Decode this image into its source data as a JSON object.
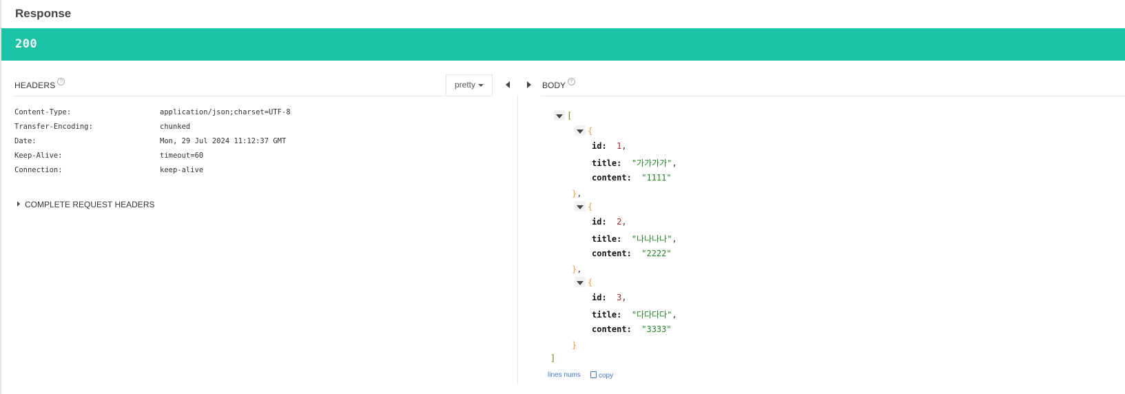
{
  "response": {
    "title": "Response",
    "status_code": "200"
  },
  "headers_panel": {
    "title": "HEADERS",
    "help": "?",
    "format_dropdown": "pretty",
    "rows": [
      {
        "key": "Content-Type:",
        "value": "application/json;charset=UTF-8"
      },
      {
        "key": "Transfer-Encoding:",
        "value": "chunked"
      },
      {
        "key": "Date:",
        "value": "Mon, 29 Jul 2024 11:12:37 GMT"
      },
      {
        "key": "Keep-Alive:",
        "value": "timeout=60"
      },
      {
        "key": "Connection:",
        "value": "keep-alive"
      }
    ],
    "complete_request_headers": "COMPLETE REQUEST HEADERS"
  },
  "body_panel": {
    "title": "BODY",
    "help": "?",
    "json_open": "[",
    "json_close": "]",
    "items": [
      {
        "id_key": "id:",
        "id": "1",
        "title_key": "title:",
        "title": "\"가가가가\"",
        "content_key": "content:",
        "content": "\"1111\""
      },
      {
        "id_key": "id:",
        "id": "2",
        "title_key": "title:",
        "title": "\"나나나나\"",
        "content_key": "content:",
        "content": "\"2222\""
      },
      {
        "id_key": "id:",
        "id": "3",
        "title_key": "title:",
        "title": "\"다다다다\"",
        "content_key": "content:",
        "content": "\"3333\""
      }
    ],
    "footer": {
      "lines_nums": "lines nums",
      "copy": "copy"
    }
  },
  "colors": {
    "status_bar": "#1bc4a4",
    "json_string": "#1a8a1a",
    "json_number": "#b22222",
    "json_brace": "#f0a030",
    "link": "#3a7bc8"
  }
}
